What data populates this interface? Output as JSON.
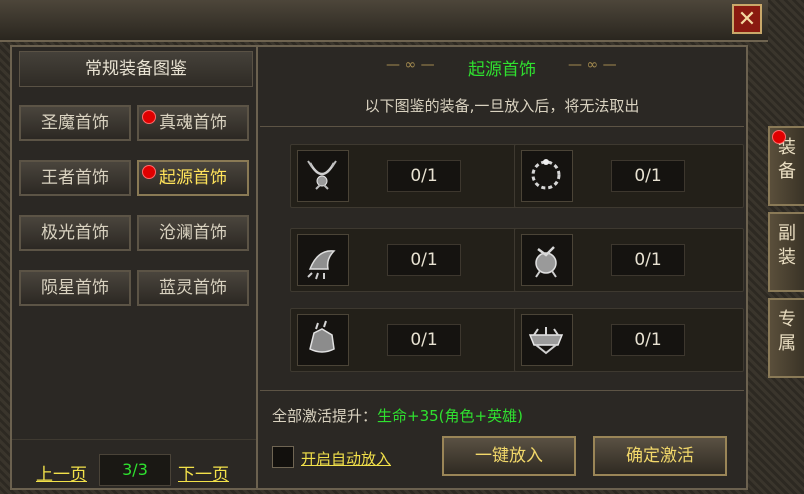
{
  "window": {
    "close_glyph": "✕"
  },
  "left": {
    "title": "常规装备图鉴",
    "categories": [
      {
        "label": "圣魔首饰",
        "dot": false,
        "active": false
      },
      {
        "label": "真魂首饰",
        "dot": true,
        "active": false
      },
      {
        "label": "王者首饰",
        "dot": false,
        "active": false
      },
      {
        "label": "起源首饰",
        "dot": true,
        "active": true
      },
      {
        "label": "极光首饰",
        "dot": false,
        "active": false
      },
      {
        "label": "沧澜首饰",
        "dot": false,
        "active": false
      },
      {
        "label": "陨星首饰",
        "dot": false,
        "active": false
      },
      {
        "label": "蓝灵首饰",
        "dot": false,
        "active": false
      }
    ],
    "pager": {
      "prev": "上一页",
      "page": "3/3",
      "next": "下一页"
    }
  },
  "right": {
    "title": "起源首饰",
    "ornament_left": "— ∞ —",
    "ornament_right": "— ∞ —",
    "subtitle": "以下图鉴的装备,一旦放入后，将无法取出",
    "slots": [
      {
        "icon": "necklace-icon",
        "count": "0/1"
      },
      {
        "icon": "ring-circle-icon",
        "count": "0/1"
      },
      {
        "icon": "bracelet-claw-icon",
        "count": "0/1"
      },
      {
        "icon": "helmet-ornament-icon",
        "count": "0/1"
      },
      {
        "icon": "gauntlet-icon",
        "count": "0/1"
      },
      {
        "icon": "crown-band-icon",
        "count": "0/1"
      }
    ],
    "bonus_label": "全部激活提升：",
    "bonus_value": "生命+35(角色+英雄)",
    "auto_put_label": "开启自动放入",
    "one_click_label": "一键放入",
    "confirm_label": "确定激活"
  },
  "side_tabs": [
    {
      "label": "装备",
      "dot": true
    },
    {
      "label": "副装",
      "dot": false
    },
    {
      "label": "专属",
      "dot": false
    }
  ],
  "colors": {
    "accent_green": "#2fe02f",
    "accent_yellow": "#f2e14a",
    "dot_red": "#e00000"
  }
}
